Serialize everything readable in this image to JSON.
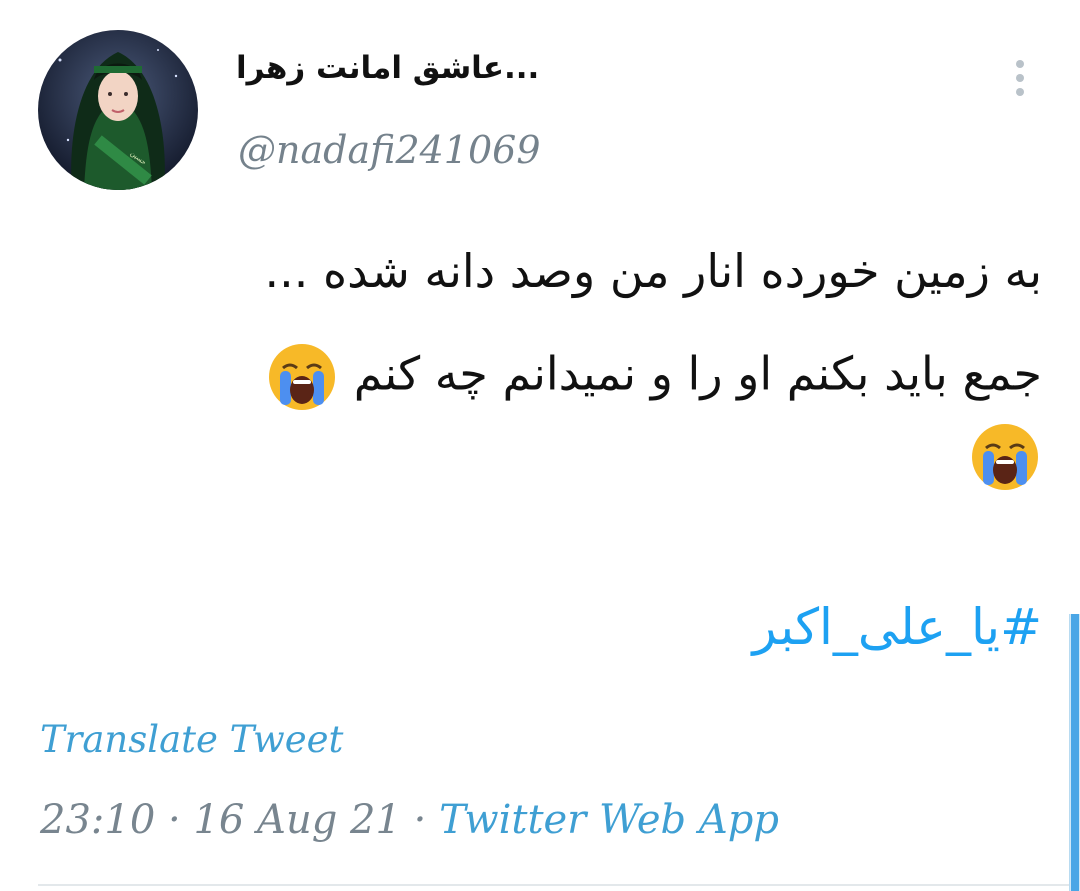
{
  "author": {
    "display_name": "عاشق امانت زهرا...",
    "handle": "@nadafi241069",
    "avatar_icon": "profile-avatar"
  },
  "tweet": {
    "line_1": "به زمین خورده انار من وصد دانه شده ...",
    "line_2": "جمع باید بکنم او را و نمیدانم چه کنم",
    "emoji_icon": "loudly-crying-face-emoji",
    "hashtag": "#یا_علی_اکبر"
  },
  "actions": {
    "translate": "Translate Tweet",
    "more_icon": "more-vertical-icon"
  },
  "meta": {
    "time": "23:10",
    "separator": "·",
    "date": "16 Aug 21",
    "source": "Twitter Web App"
  },
  "colors": {
    "link": "#1da1f2",
    "translate": "#3f9fd3",
    "muted": "#78858f",
    "text": "#111111"
  }
}
